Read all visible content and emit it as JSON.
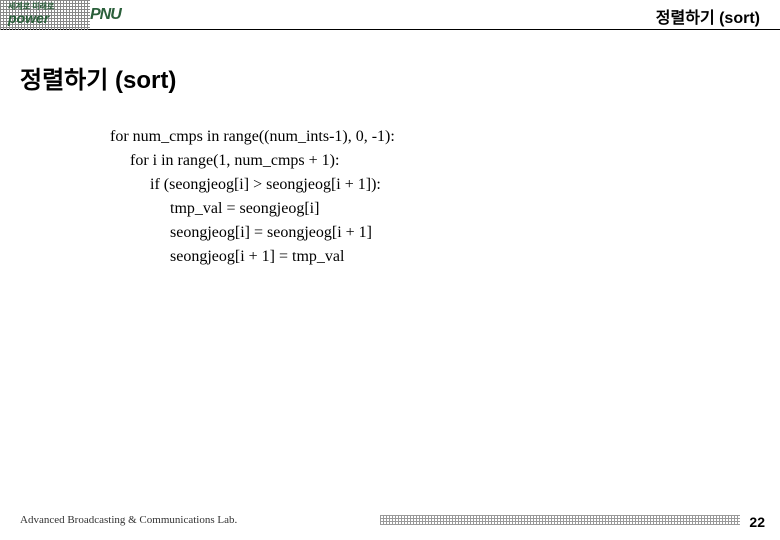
{
  "header": {
    "logo_small": "세계로 미래로",
    "logo_power": "power",
    "logo_pnu": "PNU",
    "title": "정렬하기 (sort)"
  },
  "main": {
    "title": "정렬하기 (sort)",
    "code": {
      "line1": "for num_cmps in range((num_ints-1), 0, -1):",
      "line2": "for i in range(1, num_cmps + 1):",
      "line3": "if (seongjeog[i] > seongjeog[i + 1]):",
      "line4": "tmp_val = seongjeog[i]",
      "line5": "seongjeog[i] = seongjeog[i + 1]",
      "line6": "seongjeog[i + 1] = tmp_val"
    }
  },
  "footer": {
    "lab": "Advanced Broadcasting & Communications Lab.",
    "page": "22"
  }
}
